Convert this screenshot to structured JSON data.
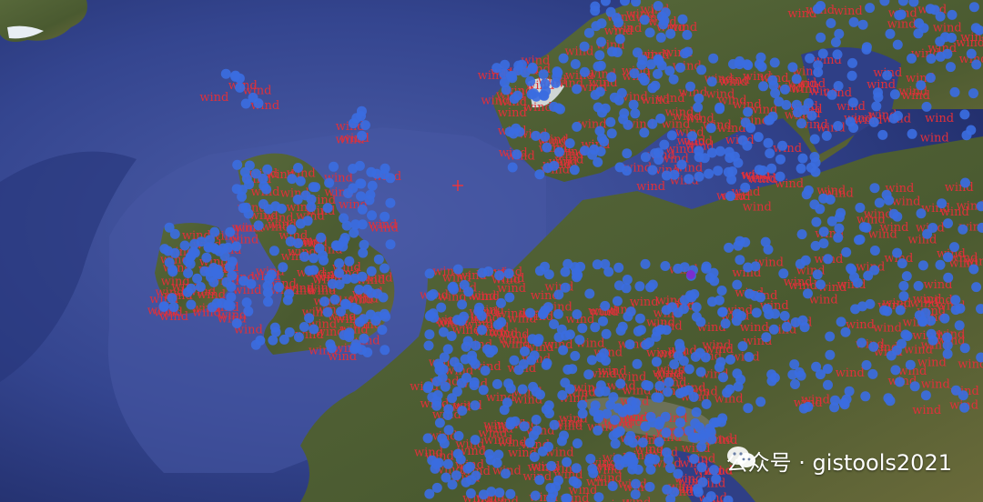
{
  "map": {
    "label_text": "wind",
    "point_color": "#3b6ce0",
    "selected_point_color": "#7a2fd0",
    "label_color": "#e0303a",
    "crosshair_color": "#ff3030",
    "ocean_color": "#2f3f86",
    "land_color": "#4c5b34"
  },
  "watermark": {
    "icon": "wechat-icon",
    "text": "公众号 · gistools2021"
  }
}
